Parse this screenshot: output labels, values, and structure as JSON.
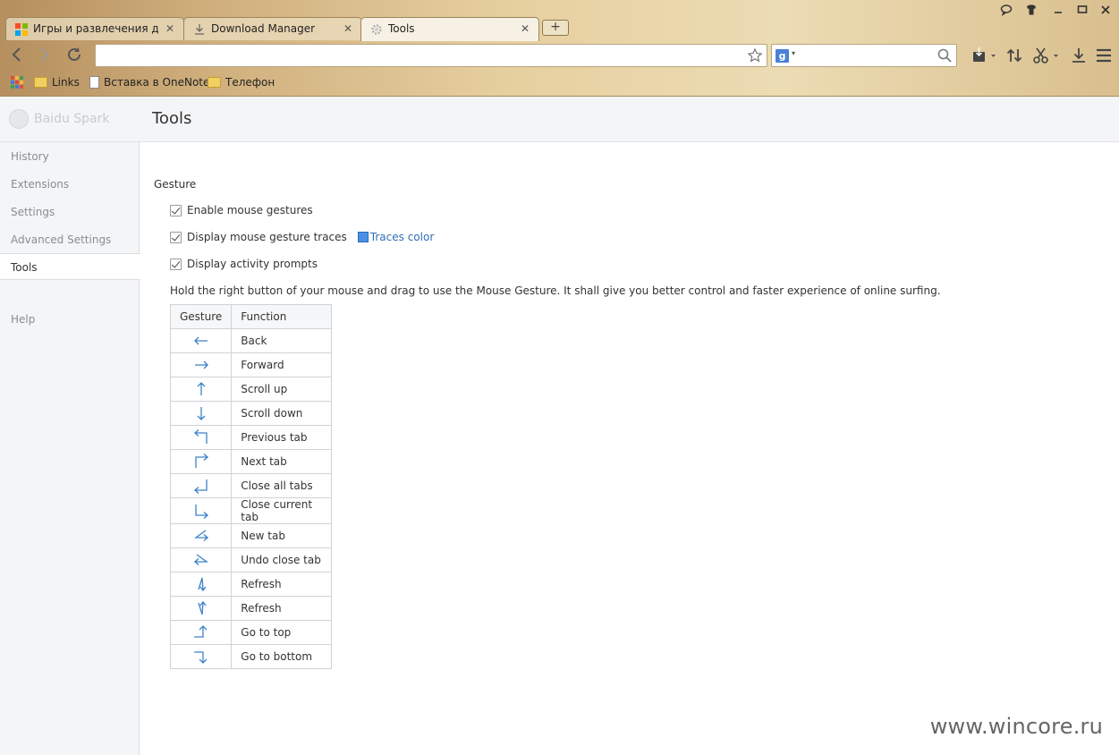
{
  "tabs": [
    {
      "title": "Игры и развлечения для",
      "active": false
    },
    {
      "title": "Download Manager",
      "active": false
    },
    {
      "title": "Tools",
      "active": true
    }
  ],
  "bookmarks": [
    "Links",
    "Вставка в OneNote",
    "Телефон"
  ],
  "brand": "Baidu Spark",
  "page_title": "Tools",
  "sidebar": {
    "items": [
      {
        "label": "History",
        "active": false
      },
      {
        "label": "Extensions",
        "active": false
      },
      {
        "label": "Settings",
        "active": false
      },
      {
        "label": "Advanced Settings",
        "active": false
      },
      {
        "label": "Tools",
        "active": true
      },
      {
        "label": "Help",
        "active": false
      }
    ]
  },
  "gesture": {
    "section_title": "Gesture",
    "options": [
      {
        "label": "Enable mouse gestures",
        "checked": true
      },
      {
        "label": "Display mouse gesture traces",
        "checked": true
      },
      {
        "label": "Display activity prompts",
        "checked": true
      }
    ],
    "traces_color_label": "Traces color",
    "traces_color": "#4a90e2",
    "description": "Hold the right button of your mouse and drag to use the Mouse Gesture. It shall give you better control and faster experience of online surfing.",
    "table": {
      "headers": [
        "Gesture",
        "Function"
      ],
      "rows": [
        {
          "icon": "arrow-left-icon",
          "function": "Back"
        },
        {
          "icon": "arrow-right-icon",
          "function": "Forward"
        },
        {
          "icon": "arrow-up-icon",
          "function": "Scroll up"
        },
        {
          "icon": "arrow-down-icon",
          "function": "Scroll down"
        },
        {
          "icon": "up-left-icon",
          "function": "Previous tab"
        },
        {
          "icon": "up-right-icon",
          "function": "Next tab"
        },
        {
          "icon": "down-left-icon",
          "function": "Close all tabs"
        },
        {
          "icon": "down-right-icon",
          "function": "Close current tab"
        },
        {
          "icon": "left-angle-icon",
          "function": "New tab"
        },
        {
          "icon": "right-angle-icon",
          "function": "Undo close tab"
        },
        {
          "icon": "up-down-icon",
          "function": "Refresh"
        },
        {
          "icon": "down-up-icon",
          "function": "Refresh"
        },
        {
          "icon": "right-up-icon",
          "function": "Go to top"
        },
        {
          "icon": "right-down-icon",
          "function": "Go to bottom"
        }
      ]
    }
  },
  "watermark": "www.wincore.ru",
  "colors": {
    "accent": "#2e6fb7",
    "gesture_stroke": "#3b82c8"
  }
}
